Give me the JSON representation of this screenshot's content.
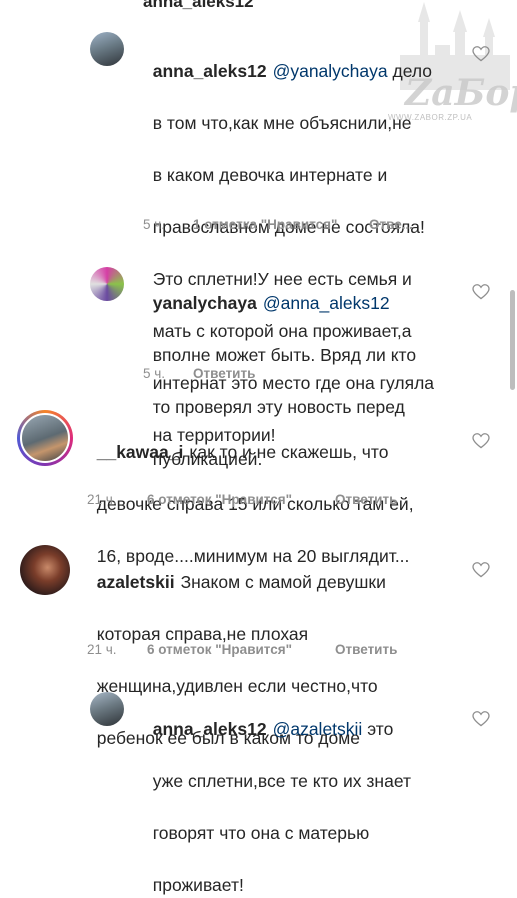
{
  "top_partial": "anna_aleks12",
  "watermark": {
    "brand": "ZаБор",
    "url": "WWW.ZABOR.ZP.UA"
  },
  "comments": [
    {
      "user": "anna_aleks12",
      "mention": "@yanalychaya",
      "lines": [
        "дело",
        "в том что,как мне объяснили,не",
        "в каком девочка интернате и",
        "православном доме не состояла!",
        "Это сплетни!У нее есть семья и",
        "мать с которой она проживает,а",
        "интернат это место где она гуляла",
        "на территории!"
      ],
      "time": "5 ч.",
      "likes": "1 отметка \"Нравится\"",
      "reply": "Отве..."
    },
    {
      "user": "yanalychaya",
      "mention": "@anna_aleks12",
      "lines": [
        "",
        "вполне может быть. Вряд ли кто",
        "то проверял эту новость перед",
        "публикацией."
      ],
      "time": "5 ч.",
      "likes": "",
      "reply": "Ответить"
    },
    {
      "user": "__kawaa_i",
      "mention": "",
      "lines": [
        "как то и не скажешь, что",
        "девочке справа 15 или сколько там ей,",
        "16, вроде....минимум на 20 выглядит..."
      ],
      "time": "21 ч.",
      "likes": "6 отметок \"Нравится\"",
      "reply": "Ответить"
    },
    {
      "user": "azaletskii",
      "mention": "",
      "lines": [
        "Знаком с мамой девушки",
        "которая справа,не плохая",
        "женщина,удивлен если честно,что",
        "ребенок ее был в каком то доме"
      ],
      "time": "21 ч.",
      "likes": "6 отметок \"Нравится\"",
      "reply": "Ответить"
    },
    {
      "user": "anna_aleks12",
      "mention": "@azaletskii",
      "lines": [
        "это",
        "уже сплетни,все те кто их знает",
        "говорят что она с матерью",
        "проживает!"
      ],
      "time": "",
      "likes": "",
      "reply": ""
    }
  ]
}
